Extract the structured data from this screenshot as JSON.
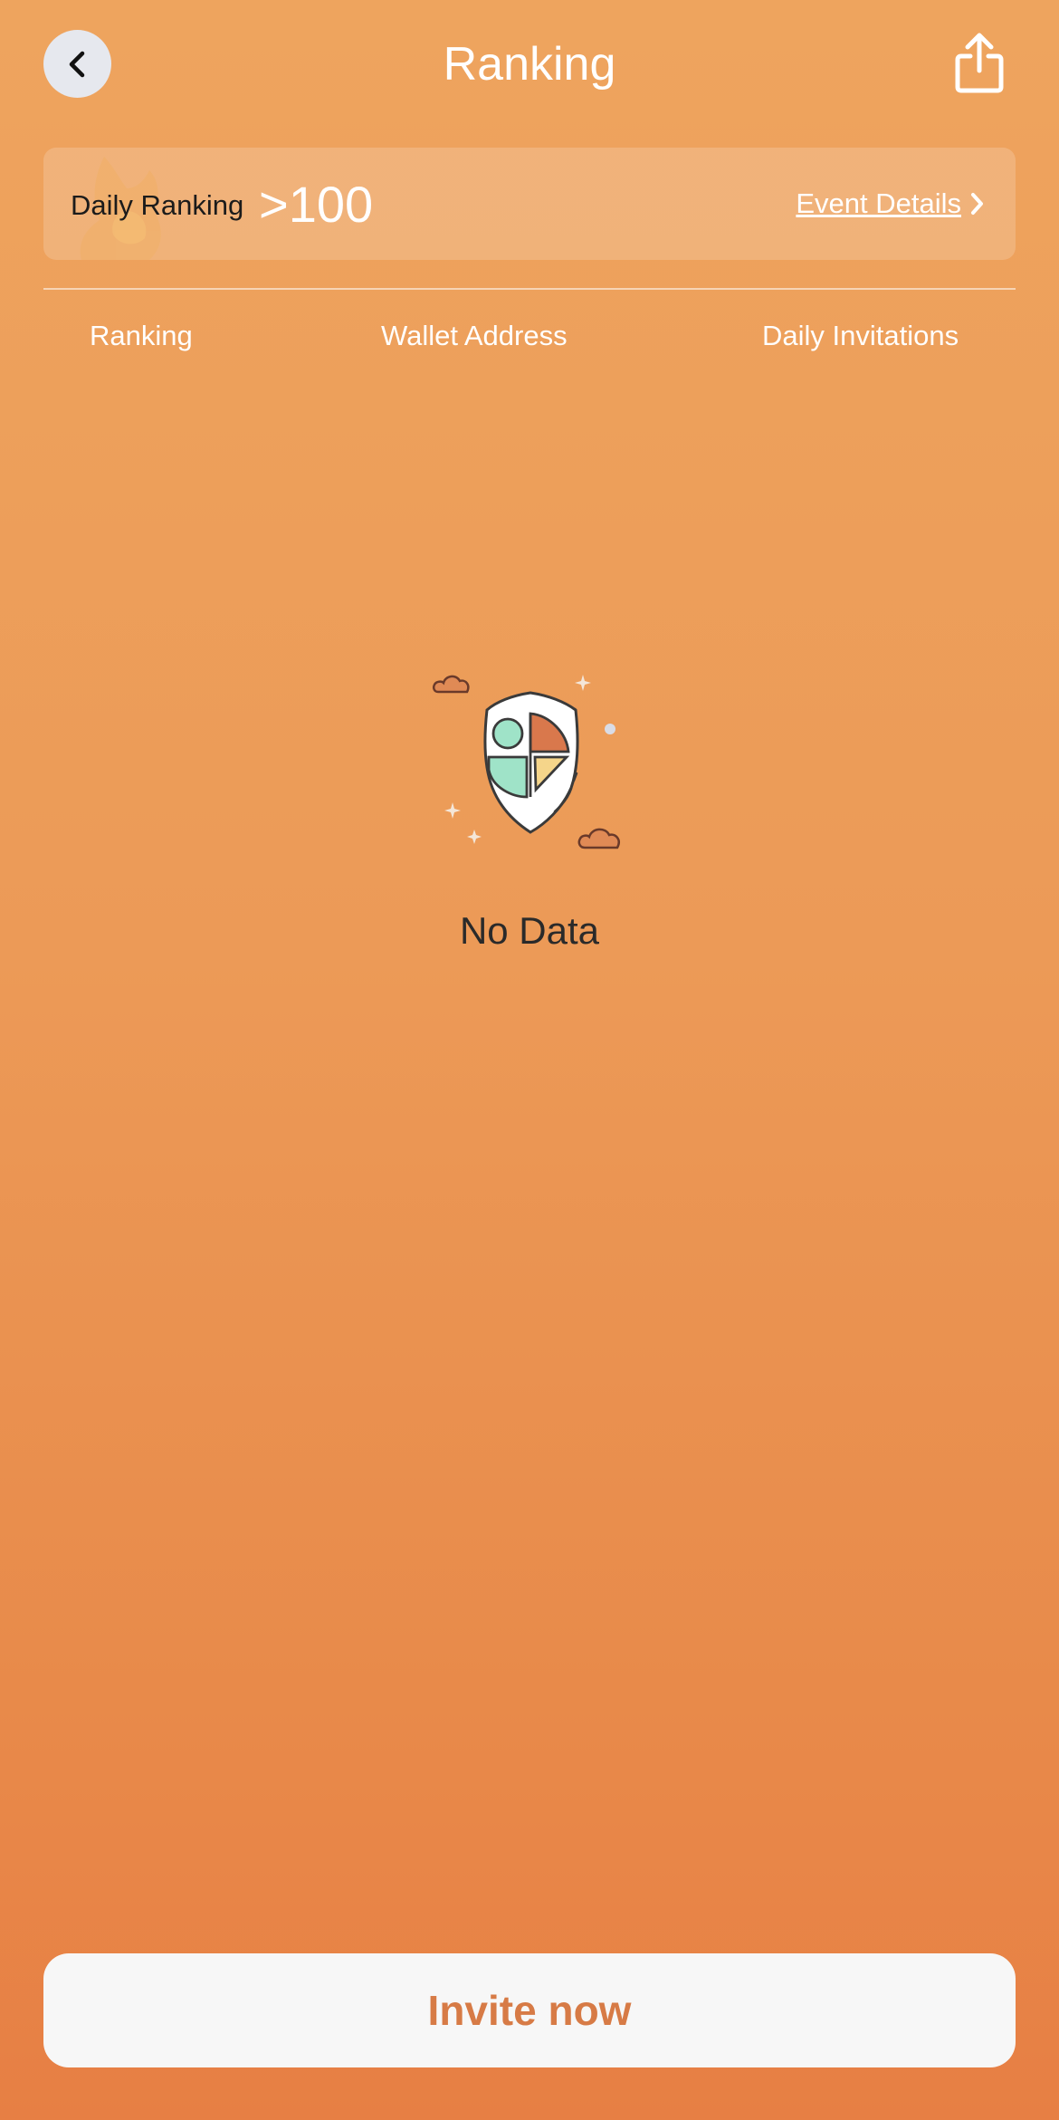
{
  "header": {
    "title": "Ranking",
    "back_icon": "chevron-left-icon",
    "share_icon": "share-icon"
  },
  "summary": {
    "label": "Daily Ranking",
    "value": ">100",
    "event_link": "Event Details",
    "event_icon": "chevron-right-icon"
  },
  "table": {
    "columns": [
      "Ranking",
      "Wallet Address",
      "Daily Invitations"
    ],
    "rows": []
  },
  "empty_state": {
    "icon": "empty-shield-icon",
    "text": "No Data"
  },
  "footer": {
    "invite_label": "Invite now"
  },
  "colors": {
    "background_top": "#EEA45E",
    "background_bottom": "#E77F44",
    "button_text": "#D77B46",
    "button_bg": "#F7F7F7"
  }
}
